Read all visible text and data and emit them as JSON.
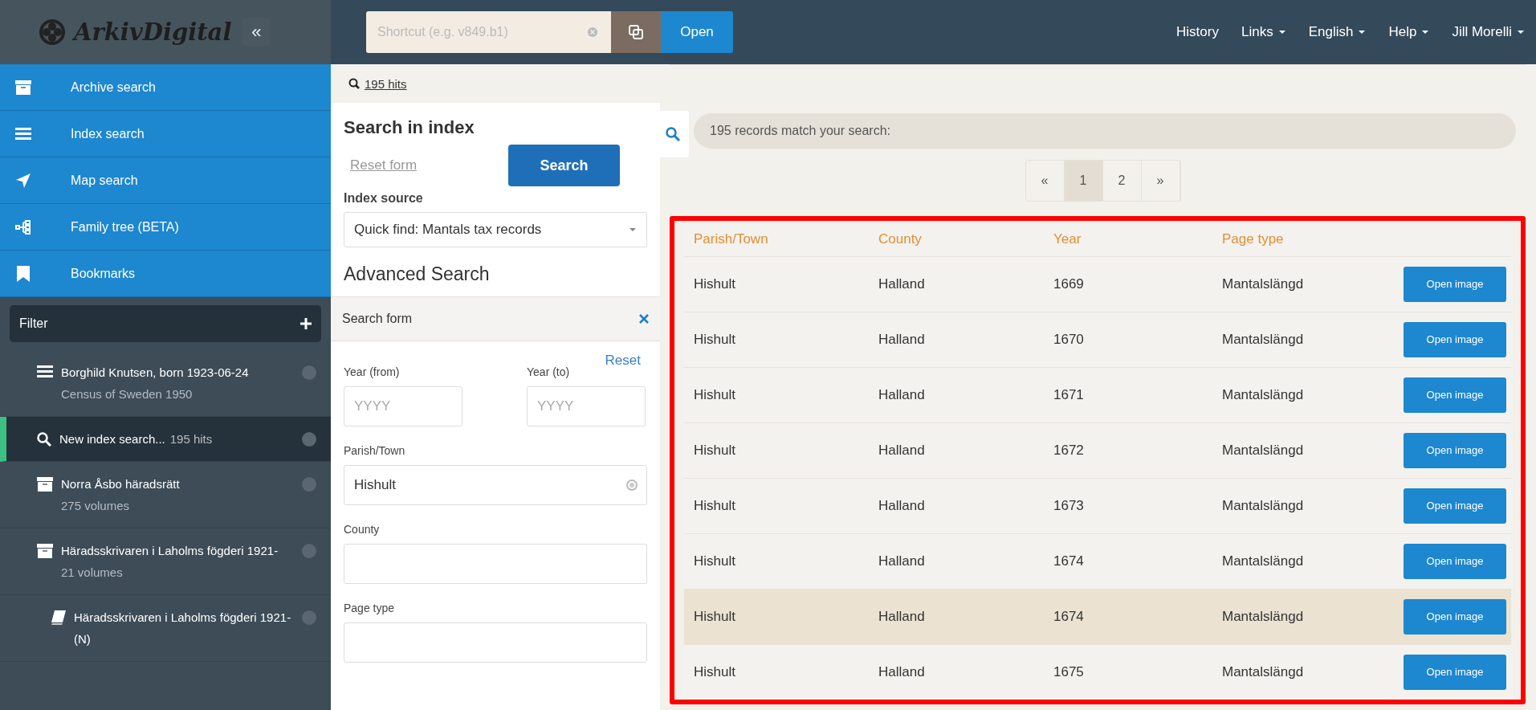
{
  "header": {
    "logo": "ArkivDigital",
    "collapse_icon": "«",
    "shortcut": {
      "placeholder": "Shortcut (e.g. v849.b1)"
    },
    "open_button": "Open",
    "menu": [
      {
        "label": "History",
        "dropdown": false
      },
      {
        "label": "Links",
        "dropdown": true
      },
      {
        "label": "English",
        "dropdown": true
      },
      {
        "label": "Help",
        "dropdown": true
      },
      {
        "label": "Jill Morelli",
        "dropdown": true
      }
    ]
  },
  "sidebar": {
    "nav": [
      {
        "kind": "archive",
        "label": "Archive search"
      },
      {
        "kind": "list",
        "label": "Index search"
      },
      {
        "kind": "map",
        "label": "Map search"
      },
      {
        "kind": "tree",
        "label": "Family tree (BETA)"
      },
      {
        "kind": "bookmark",
        "label": "Bookmarks"
      }
    ],
    "filter": "Filter",
    "bookmarks": [
      {
        "kind": "list",
        "title": "Borghild Knutsen, born 1923-06-24",
        "subtitle": "Census of Sweden 1950",
        "selected": false
      },
      {
        "kind": "search",
        "title": "New index search...",
        "hits": "195 hits",
        "selected": true
      },
      {
        "kind": "archive",
        "title": "Norra Åsbo häradsrätt",
        "subtitle": "275 volumes",
        "selected": false
      },
      {
        "kind": "archive",
        "title": "Häradsskrivaren i Laholms fögderi 1921-",
        "subtitle": "21 volumes",
        "selected": false,
        "children": [
          {
            "kind": "book",
            "title": "Häradsskrivaren i Laholms fögderi 1921- (N)",
            "selected": false
          }
        ]
      }
    ]
  },
  "search_panel": {
    "hits_link": "195 hits",
    "title": "Search in index",
    "reset_form": "Reset form",
    "search_button": "Search",
    "index_source_label": "Index source",
    "index_source": "Quick find: Mantals tax records",
    "advanced_title": "Advanced Search",
    "form_title": "Search form",
    "reset": "Reset",
    "fields": [
      {
        "kind": "half",
        "label": "Year (from)",
        "placeholder": "YYYY"
      },
      {
        "kind": "half",
        "label": "Year (to)",
        "placeholder": "YYYY"
      },
      {
        "kind": "clearable",
        "label": "Parish/Town",
        "value": "Hishult"
      },
      {
        "kind": "full",
        "label": "County"
      },
      {
        "kind": "full",
        "label": "Page type"
      }
    ]
  },
  "results": {
    "summary": "195 records match your search:",
    "pagination": [
      {
        "label": "«",
        "selected": false
      },
      {
        "label": "1",
        "selected": true
      },
      {
        "label": "2",
        "selected": false
      },
      {
        "label": "»",
        "selected": false
      }
    ],
    "table": {
      "columns": [
        "Parish/Town",
        "County",
        "Year",
        "Page type"
      ],
      "rows": [
        {
          "cells": [
            "Hishult",
            "Halland",
            "1669",
            "Mantalslängd"
          ],
          "button": "Open image",
          "highlighted": false
        },
        {
          "cells": [
            "Hishult",
            "Halland",
            "1670",
            "Mantalslängd"
          ],
          "button": "Open image",
          "highlighted": false
        },
        {
          "cells": [
            "Hishult",
            "Halland",
            "1671",
            "Mantalslängd"
          ],
          "button": "Open image",
          "highlighted": false
        },
        {
          "cells": [
            "Hishult",
            "Halland",
            "1672",
            "Mantalslängd"
          ],
          "button": "Open image",
          "highlighted": false
        },
        {
          "cells": [
            "Hishult",
            "Halland",
            "1673",
            "Mantalslängd"
          ],
          "button": "Open image",
          "highlighted": false
        },
        {
          "cells": [
            "Hishult",
            "Halland",
            "1674",
            "Mantalslängd"
          ],
          "button": "Open image",
          "highlighted": false
        },
        {
          "cells": [
            "Hishult",
            "Halland",
            "1674",
            "Mantalslängd"
          ],
          "button": "Open image",
          "highlighted": true
        },
        {
          "cells": [
            "Hishult",
            "Halland",
            "1675",
            "Mantalslängd"
          ],
          "button": "Open image",
          "highlighted": false
        }
      ]
    },
    "annotation_frame": true
  }
}
